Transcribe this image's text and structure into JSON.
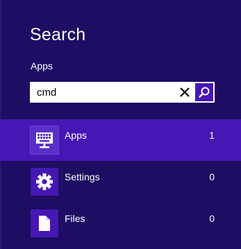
{
  "search": {
    "title": "Search",
    "scope": "Apps",
    "query": "cmd",
    "placeholder": ""
  },
  "results": [
    {
      "label": "Apps",
      "count": "1",
      "icon": "keyboard-monitor-icon",
      "selected": true
    },
    {
      "label": "Settings",
      "count": "0",
      "icon": "gear-icon",
      "selected": false
    },
    {
      "label": "Files",
      "count": "0",
      "icon": "document-icon",
      "selected": false
    }
  ],
  "colors": {
    "background": "#1e0d62",
    "accent": "#4617b4",
    "text": "#ffffff"
  }
}
